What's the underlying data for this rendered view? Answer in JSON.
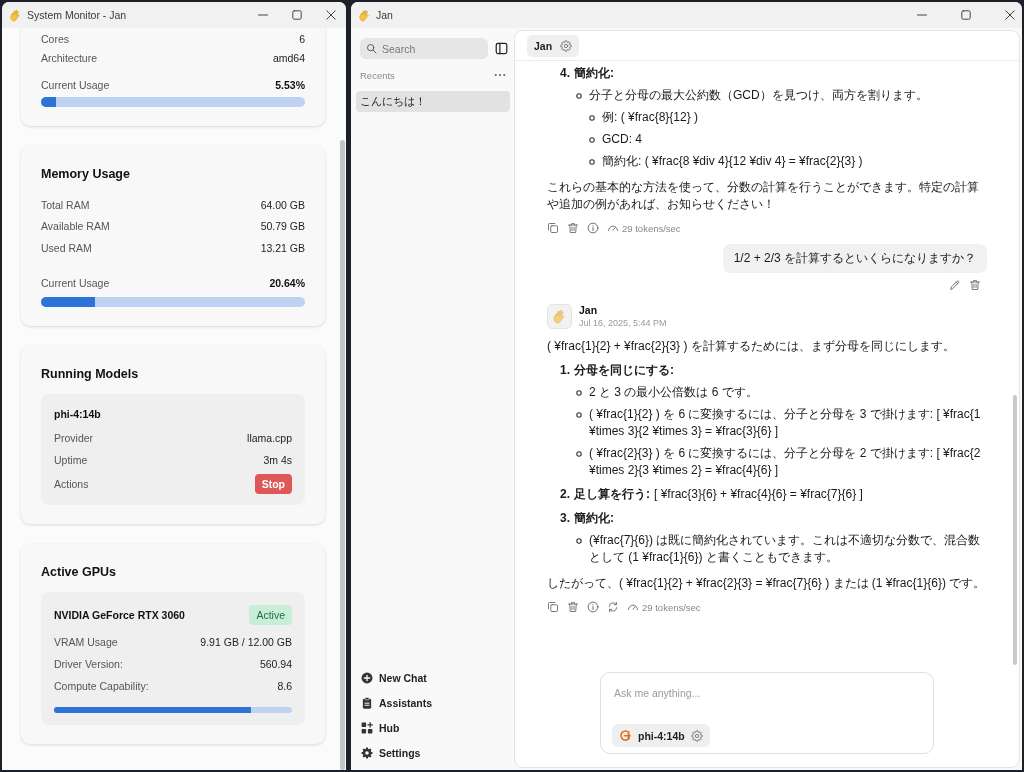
{
  "system_monitor": {
    "window": {
      "title": "System Monitor - Jan"
    },
    "cpu": {
      "rows": [
        {
          "label": "Cores",
          "value": "6"
        },
        {
          "label": "Architecture",
          "value": "amd64"
        }
      ],
      "usage": {
        "label": "Current Usage",
        "reading": "5.53%",
        "level": 0.0553
      }
    },
    "memory": {
      "title": "Memory Usage",
      "rows": [
        {
          "label": "Total RAM",
          "value": "64.00 GB"
        },
        {
          "label": "Available RAM",
          "value": "50.79 GB"
        },
        {
          "label": "Used RAM",
          "value": "13.21 GB"
        }
      ],
      "usage": {
        "label": "Current Usage",
        "reading": "20.64%",
        "level": 0.2064
      }
    },
    "running_models": {
      "title": "Running Models",
      "models": [
        {
          "name": "phi-4:14b",
          "rows": [
            {
              "label": "Provider",
              "value": "llama.cpp"
            },
            {
              "label": "Uptime",
              "value": "3m 4s"
            }
          ],
          "actions_label": "Actions",
          "stop_button": "Stop"
        }
      ]
    },
    "active_gpus": {
      "title": "Active GPUs",
      "gpus": [
        {
          "name": "NVIDIA GeForce RTX 3060",
          "status": "Active",
          "rows": [
            {
              "label": "VRAM Usage",
              "value": "9.91 GB / 12.00 GB"
            },
            {
              "label": "Driver Version:",
              "value": "560.94"
            },
            {
              "label": "Compute Capability:",
              "value": "8.6"
            }
          ],
          "level": 0.826
        }
      ]
    }
  },
  "jan": {
    "window": {
      "title": "Jan"
    },
    "sidebar": {
      "search": {
        "placeholder": "Search"
      },
      "recents_label": "Recents",
      "recents": [
        {
          "title": "こんにちは！",
          "selected": true
        }
      ],
      "nav": [
        {
          "label": "New Chat"
        },
        {
          "label": "Assistants"
        },
        {
          "label": "Hub"
        },
        {
          "label": "Settings"
        }
      ]
    },
    "header": {
      "assistant": "Jan"
    },
    "messages": [
      {
        "kind": "assistant",
        "blocks": [
          {
            "kind": "ordered",
            "number": "4.",
            "heading": "簡約化:",
            "children": [
              {
                "text": "分子と分母の最大公約数（GCD）を見つけ、両方を割ります。",
                "children": [
                  {
                    "text": "例: ( ¥frac{8}{12} )"
                  },
                  {
                    "text": "GCD: 4"
                  },
                  {
                    "text": "簡約化: ( ¥frac{8 ¥div 4}{12 ¥div 4} = ¥frac{2}{3} )"
                  }
                ]
              }
            ]
          },
          {
            "kind": "paragraph",
            "text": "これらの基本的な方法を使って、分数の計算を行うことができます。特定の計算や追加の例があれば、お知らせください！"
          }
        ],
        "regenerate": false,
        "speed": "29 tokens/sec"
      },
      {
        "kind": "user",
        "text": "1/2 + 2/3 を計算するといくらになりますか？"
      },
      {
        "kind": "assistant",
        "author": "Jan",
        "time": "Jul 16, 2025, 5:44 PM",
        "blocks": [
          {
            "kind": "paragraph",
            "text": "( ¥frac{1}{2} + ¥frac{2}{3} ) を計算するためには、まず分母を同じにします。"
          },
          {
            "kind": "ordered",
            "number": "1.",
            "heading": "分母を同じにする:",
            "children": [
              {
                "text": "2 と 3 の最小公倍数は 6 です。"
              },
              {
                "text": "( ¥frac{1}{2} ) を 6 に変換するには、分子と分母を 3 で掛けます: [ ¥frac{1 ¥times 3}{2 ¥times 3} = ¥frac{3}{6} ]"
              },
              {
                "text": "( ¥frac{2}{3} ) を 6 に変換するには、分子と分母を 2 で掛けます: [ ¥frac{2 ¥times 2}{3 ¥times 2} = ¥frac{4}{6} ]"
              }
            ]
          },
          {
            "kind": "ordered",
            "number": "2.",
            "heading": "足し算を行う:",
            "text": "[ ¥frac{3}{6} + ¥frac{4}{6} = ¥frac{7}{6} ]"
          },
          {
            "kind": "ordered",
            "number": "3.",
            "heading": "簡約化:",
            "children": [
              {
                "text": "(¥frac{7}{6}) は既に簡約化されています。これは不適切な分数で、混合数として (1 ¥frac{1}{6}) と書くこともできます。"
              }
            ]
          },
          {
            "kind": "paragraph",
            "text": "したがって、( ¥frac{1}{2} + ¥frac{2}{3} = ¥frac{7}{6} ) または (1 ¥frac{1}{6}) です。"
          }
        ],
        "regenerate": true,
        "speed": "29 tokens/sec"
      }
    ],
    "composer": {
      "placeholder": "Ask me anything...",
      "model": "phi-4:14b"
    }
  }
}
